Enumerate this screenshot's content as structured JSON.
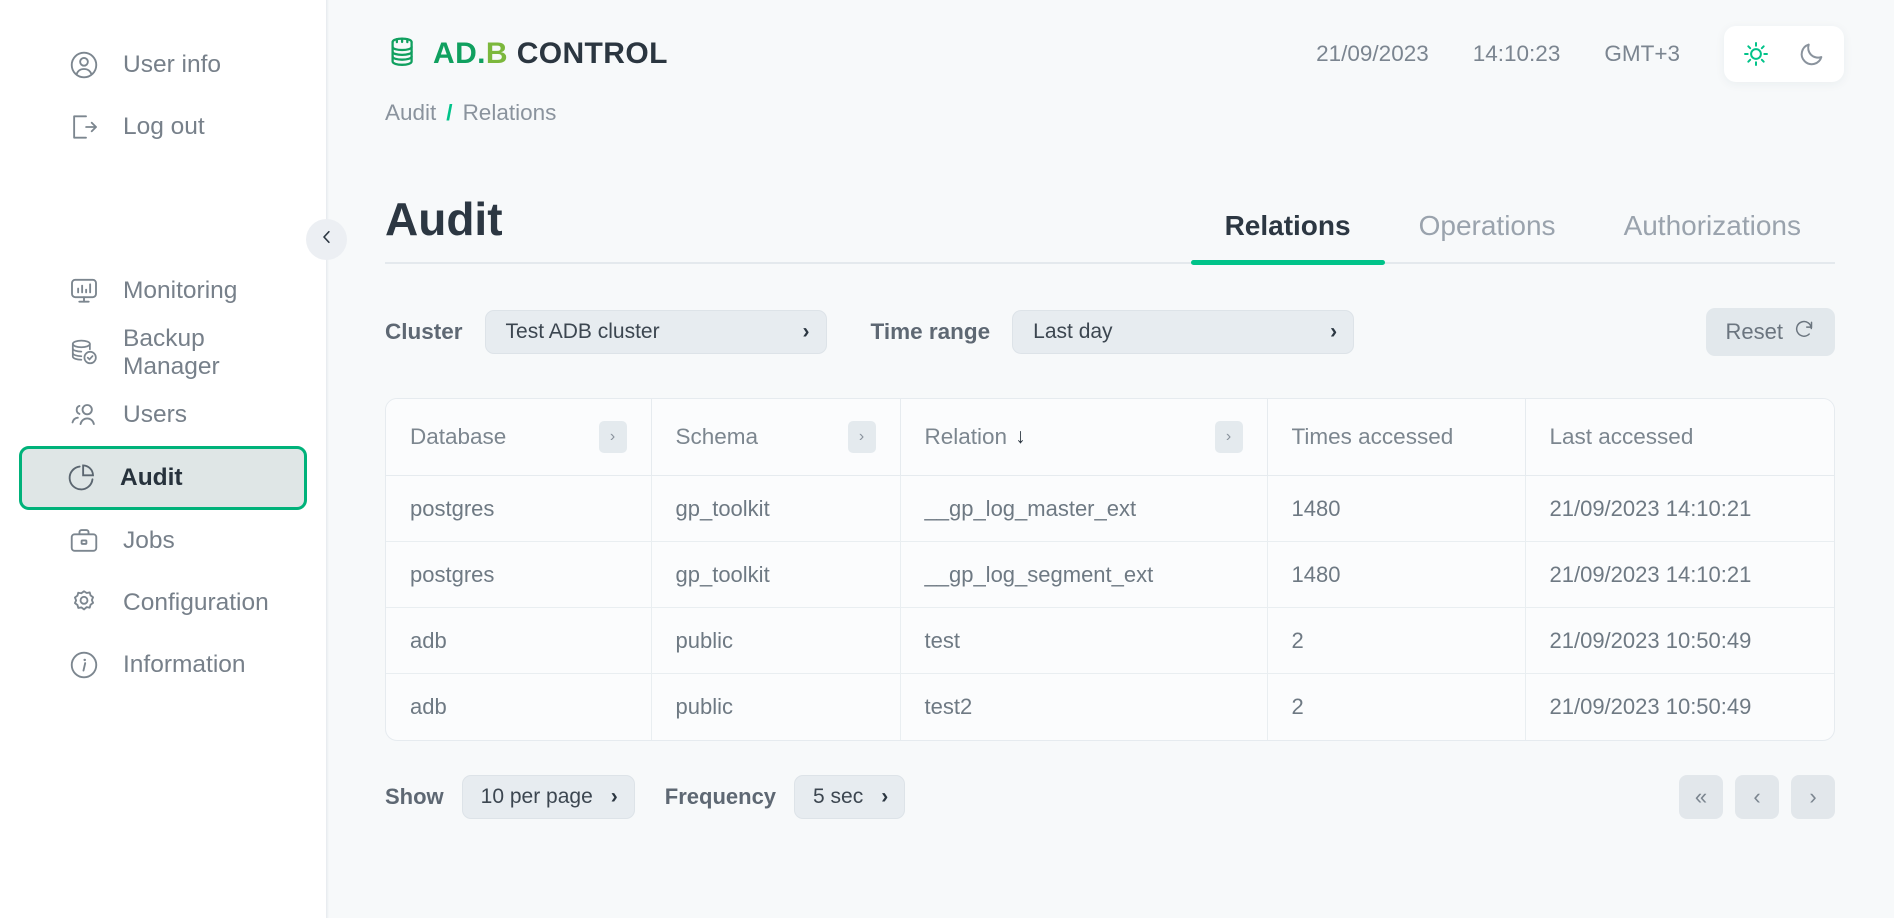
{
  "sidebar": {
    "top_items": [
      {
        "label": "User info",
        "icon": "user-circle-icon"
      },
      {
        "label": "Log out",
        "icon": "logout-icon"
      }
    ],
    "items": [
      {
        "label": "Monitoring",
        "icon": "monitor-chart-icon",
        "active": false
      },
      {
        "label": "Backup Manager",
        "icon": "database-check-icon",
        "active": false
      },
      {
        "label": "Users",
        "icon": "users-icon",
        "active": false
      },
      {
        "label": "Audit",
        "icon": "pie-chart-icon",
        "active": true
      },
      {
        "label": "Jobs",
        "icon": "briefcase-icon",
        "active": false
      },
      {
        "label": "Configuration",
        "icon": "gear-icon",
        "active": false
      },
      {
        "label": "Information",
        "icon": "info-circle-icon",
        "active": false
      }
    ],
    "collapse_icon": "chevron-left-icon"
  },
  "header": {
    "logo": {
      "mark": "database-stack-icon",
      "part1": "AD.",
      "part2": "B",
      "part3": " CONTROL"
    },
    "date": "21/09/2023",
    "time": "14:10:23",
    "timezone": "GMT+3",
    "theme": {
      "light_icon": "sun-icon",
      "dark_icon": "moon-icon",
      "active": "light"
    }
  },
  "breadcrumb": {
    "root": "Audit",
    "separator": "/",
    "current": "Relations"
  },
  "page": {
    "title": "Audit"
  },
  "tabs": [
    {
      "label": "Relations",
      "active": true
    },
    {
      "label": "Operations",
      "active": false
    },
    {
      "label": "Authorizations",
      "active": false
    }
  ],
  "filters": {
    "cluster_label": "Cluster",
    "cluster_value": "Test ADB cluster",
    "time_range_label": "Time range",
    "time_range_value": "Last day",
    "reset_label": "Reset",
    "reset_icon": "refresh-icon"
  },
  "table": {
    "columns": [
      {
        "label": "Database",
        "filter": true,
        "sorted": false
      },
      {
        "label": "Schema",
        "filter": true,
        "sorted": false
      },
      {
        "label": "Relation",
        "filter": true,
        "sorted": true,
        "sort_icon": "arrow-down-icon"
      },
      {
        "label": "Times accessed",
        "filter": false,
        "sorted": false
      },
      {
        "label": "Last accessed",
        "filter": false,
        "sorted": false
      }
    ],
    "rows": [
      {
        "database": "postgres",
        "schema": "gp_toolkit",
        "relation": "__gp_log_master_ext",
        "times": "1480",
        "last": "21/09/2023 14:10:21"
      },
      {
        "database": "postgres",
        "schema": "gp_toolkit",
        "relation": "__gp_log_segment_ext",
        "times": "1480",
        "last": "21/09/2023 14:10:21"
      },
      {
        "database": "adb",
        "schema": "public",
        "relation": "test",
        "times": "2",
        "last": "21/09/2023 10:50:49"
      },
      {
        "database": "adb",
        "schema": "public",
        "relation": "test2",
        "times": "2",
        "last": "21/09/2023 10:50:49"
      }
    ]
  },
  "footer": {
    "show_label": "Show",
    "show_value": "10 per page",
    "frequency_label": "Frequency",
    "frequency_value": "5 sec",
    "pager": [
      {
        "icon": "chevrons-left-icon",
        "glyph": "«"
      },
      {
        "icon": "chevron-left-icon",
        "glyph": "‹"
      },
      {
        "icon": "chevron-right-icon",
        "glyph": "›"
      }
    ]
  },
  "colors": {
    "accent": "#00c389",
    "accent_dark": "#10a05f",
    "accent_light": "#7cb83c",
    "text_dark": "#2c3742",
    "text_muted": "#7c868f"
  }
}
